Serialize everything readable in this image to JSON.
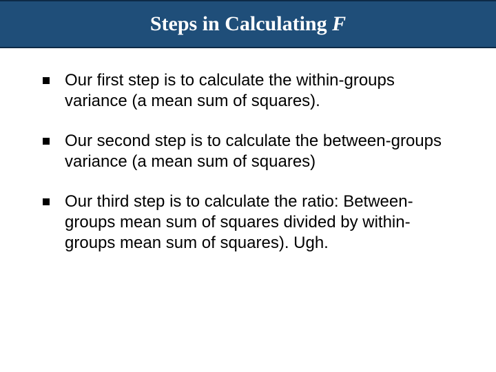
{
  "title": {
    "prefix": "Steps in Calculating ",
    "variable": "F"
  },
  "bullets": [
    "Our first step is to calculate the within-groups variance (a mean sum of squares).",
    "Our second step is to calculate the between-groups variance (a mean sum of squares)",
    "Our third step is to calculate the ratio: Between-groups mean sum of squares divided by within-groups mean sum of squares). Ugh."
  ]
}
